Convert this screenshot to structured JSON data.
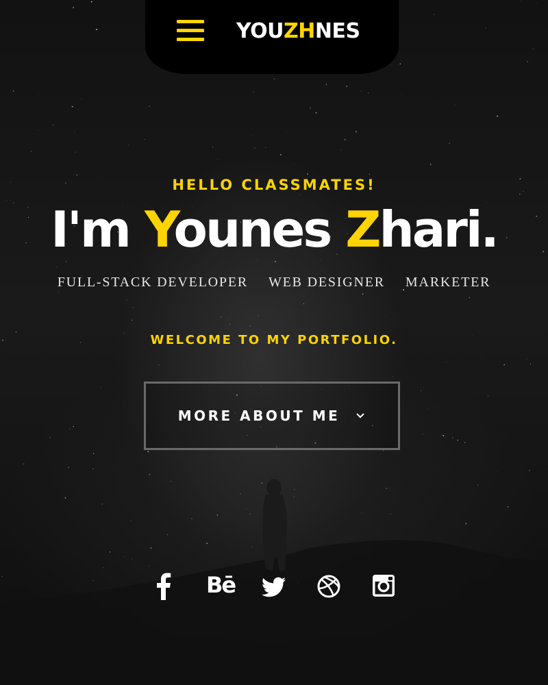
{
  "header": {
    "logo": {
      "part1": "YOU",
      "part2": "ZH",
      "part3": "NES"
    },
    "menu_icon": "hamburger-menu-icon"
  },
  "hero": {
    "greeting": "HELLO CLASSMATES!",
    "headline": {
      "prefix": "I'm ",
      "first_initial": "Y",
      "first_rest": "ounes ",
      "last_initial": "Z",
      "last_rest": "hari."
    },
    "roles": [
      "FULL-STACK DEVELOPER",
      "WEB DESIGNER",
      "MARKETER"
    ],
    "welcome": "WELCOME TO MY PORTFOLIO.",
    "cta_label": "MORE ABOUT ME",
    "cta_icon": "chevron-down-icon"
  },
  "social": {
    "icons": [
      "facebook-icon",
      "behance-icon",
      "twitter-icon",
      "dribbble-icon",
      "instagram-icon"
    ],
    "behance_text": "Bē"
  },
  "colors": {
    "accent": "#ffd400",
    "background": "#121212",
    "text": "#ffffff",
    "button_border": "#6a6a6a"
  }
}
